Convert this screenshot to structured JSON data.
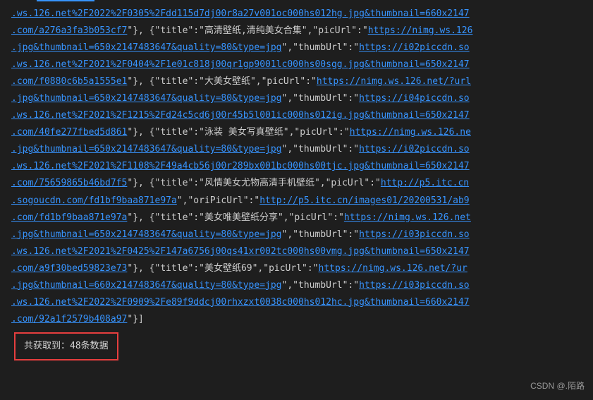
{
  "console": {
    "lines": [
      {
        "type": "link",
        "text": ".ws.126.net%2F2022%2F0305%2Fdd115d7dj00r8a27v001oc000hs012hg.jpg&thumbnail=660x2147"
      },
      {
        "segments": [
          {
            "type": "link",
            "text": ".com/a276a3fa3b053cf7"
          },
          {
            "type": "text",
            "text": "\"}, {\"title\":\"高清壁纸,清纯美女合集\",\"picUrl\":\""
          },
          {
            "type": "link",
            "text": "https://nimg.ws.126"
          }
        ]
      },
      {
        "segments": [
          {
            "type": "link",
            "text": ".jpg&thumbnail=650x2147483647&quality=80&type=jpg"
          },
          {
            "type": "text",
            "text": "\",\"thumbUrl\":\""
          },
          {
            "type": "link",
            "text": "https://i02piccdn.so"
          }
        ]
      },
      {
        "type": "link",
        "text": ".ws.126.net%2F2021%2F0404%2F1e01c818j00qr1gp9001lc000hs00sgg.jpg&thumbnail=650x2147"
      },
      {
        "segments": [
          {
            "type": "link",
            "text": ".com/f0880c6b5a1555e1"
          },
          {
            "type": "text",
            "text": "\"}, {\"title\":\"大美女壁纸\",\"picUrl\":\""
          },
          {
            "type": "link",
            "text": "https://nimg.ws.126.net/?url"
          }
        ]
      },
      {
        "segments": [
          {
            "type": "link",
            "text": ".jpg&thumbnail=650x2147483647&quality=80&type=jpg"
          },
          {
            "type": "text",
            "text": "\",\"thumbUrl\":\""
          },
          {
            "type": "link",
            "text": "https://i04piccdn.so"
          }
        ]
      },
      {
        "type": "link",
        "text": ".ws.126.net%2F2021%2F1215%2Fd24c5cd6j00r45b5l001ic000hs012ig.jpg&thumbnail=650x2147"
      },
      {
        "segments": [
          {
            "type": "link",
            "text": ".com/40fe277fbed5d861"
          },
          {
            "type": "text",
            "text": "\"}, {\"title\":\"泳装 美女写真壁纸\",\"picUrl\":\""
          },
          {
            "type": "link",
            "text": "https://nimg.ws.126.ne"
          }
        ]
      },
      {
        "segments": [
          {
            "type": "link",
            "text": ".jpg&thumbnail=650x2147483647&quality=80&type=jpg"
          },
          {
            "type": "text",
            "text": "\",\"thumbUrl\":\""
          },
          {
            "type": "link",
            "text": "https://i02piccdn.so"
          }
        ]
      },
      {
        "type": "link",
        "text": ".ws.126.net%2F2021%2F1108%2F49a4cb56j00r289bx001bc000hs00tjc.jpg&thumbnail=650x2147"
      },
      {
        "segments": [
          {
            "type": "link",
            "text": ".com/75659865b46bd7f5"
          },
          {
            "type": "text",
            "text": "\"}, {\"title\":\"风情美女尤物高清手机壁纸\",\"picUrl\":\""
          },
          {
            "type": "link",
            "text": "http://p5.itc.cn"
          }
        ]
      },
      {
        "segments": [
          {
            "type": "link",
            "text": ".sogoucdn.com/fd1bf9baa871e97a"
          },
          {
            "type": "text",
            "text": "\",\"oriPicUrl\":\""
          },
          {
            "type": "link",
            "text": "http://p5.itc.cn/images01/20200531/ab9"
          }
        ]
      },
      {
        "segments": [
          {
            "type": "link",
            "text": ".com/fd1bf9baa871e97a"
          },
          {
            "type": "text",
            "text": "\"}, {\"title\":\"美女唯美壁纸分享\",\"picUrl\":\""
          },
          {
            "type": "link",
            "text": "https://nimg.ws.126.net"
          }
        ]
      },
      {
        "segments": [
          {
            "type": "link",
            "text": ".jpg&thumbnail=650x2147483647&quality=80&type=jpg"
          },
          {
            "type": "text",
            "text": "\",\"thumbUrl\":\""
          },
          {
            "type": "link",
            "text": "https://i03piccdn.so"
          }
        ]
      },
      {
        "type": "link",
        "text": ".ws.126.net%2F2021%2F0425%2F147a6756j00qs41xr002tc000hs00vmg.jpg&thumbnail=650x2147"
      },
      {
        "segments": [
          {
            "type": "link",
            "text": ".com/a9f30bed59823e73"
          },
          {
            "type": "text",
            "text": "\"}, {\"title\":\"美女壁纸69\",\"picUrl\":\""
          },
          {
            "type": "link",
            "text": "https://nimg.ws.126.net/?ur"
          }
        ]
      },
      {
        "segments": [
          {
            "type": "link",
            "text": ".jpg&thumbnail=660x2147483647&quality=80&type=jpg"
          },
          {
            "type": "text",
            "text": "\",\"thumbUrl\":\""
          },
          {
            "type": "link",
            "text": "https://i03piccdn.so"
          }
        ]
      },
      {
        "type": "link",
        "text": ".ws.126.net%2F2022%2F0909%2Fe89f9ddcj00rhxzxt0038c000hs012hc.jpg&thumbnail=660x2147"
      },
      {
        "segments": [
          {
            "type": "link",
            "text": ".com/92a1f2579b408a97"
          },
          {
            "type": "text",
            "text": "\"}]"
          }
        ]
      }
    ],
    "result": "共获取到：48条数据"
  },
  "watermark": "CSDN @.陌路"
}
